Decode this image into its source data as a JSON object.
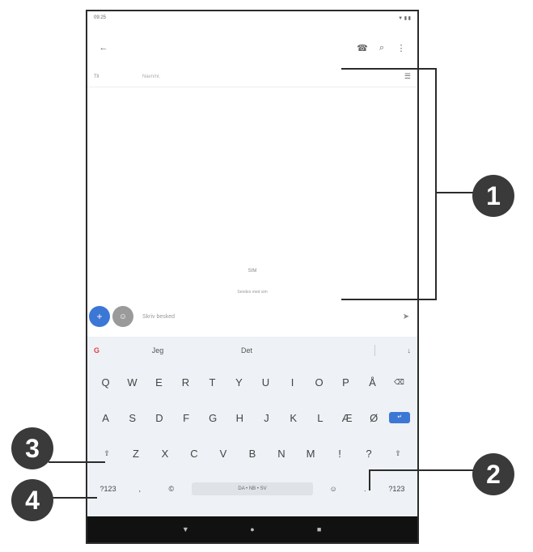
{
  "status_bar": {
    "time": "09:25",
    "icons_right": "▼ ▮ ▮"
  },
  "top_bar": {
    "back_icon": "←",
    "call_icon": "☎",
    "search_icon": "⌕",
    "menu_icon": "⋮"
  },
  "to_row": {
    "label": "Til",
    "placeholder": "Navn/nr.",
    "contact_icon": "☰"
  },
  "sim_info": {
    "line1": "SIM",
    "line2": "Sendes med sim"
  },
  "compose": {
    "add_icon": "+",
    "media_icon": "☺",
    "placeholder": "Skriv besked",
    "send_icon": "➤"
  },
  "keyboard": {
    "suggestion_g": "G",
    "suggestions": [
      "Jeg",
      "Det"
    ],
    "mic_icon": "↓",
    "row1": [
      "Q",
      "W",
      "E",
      "R",
      "T",
      "Y",
      "U",
      "I",
      "O",
      "P",
      "Å",
      "⌫"
    ],
    "row2": [
      "A",
      "S",
      "D",
      "F",
      "G",
      "H",
      "J",
      "K",
      "L",
      "Æ",
      "Ø",
      "↵"
    ],
    "row3": [
      "⇧",
      "Z",
      "X",
      "C",
      "V",
      "B",
      "N",
      "M",
      "!",
      "?",
      "⇧"
    ],
    "row4": {
      "symbols": "?123",
      "comma": ",",
      "globe": "©",
      "space": "DA • NB • SV",
      "emoji": "☺",
      "period": ".",
      "symbols_right": "?123"
    }
  },
  "nav_bar": {
    "back": "▼",
    "home": "●",
    "recents": "■"
  },
  "callouts": [
    "1",
    "2",
    "3",
    "4"
  ]
}
